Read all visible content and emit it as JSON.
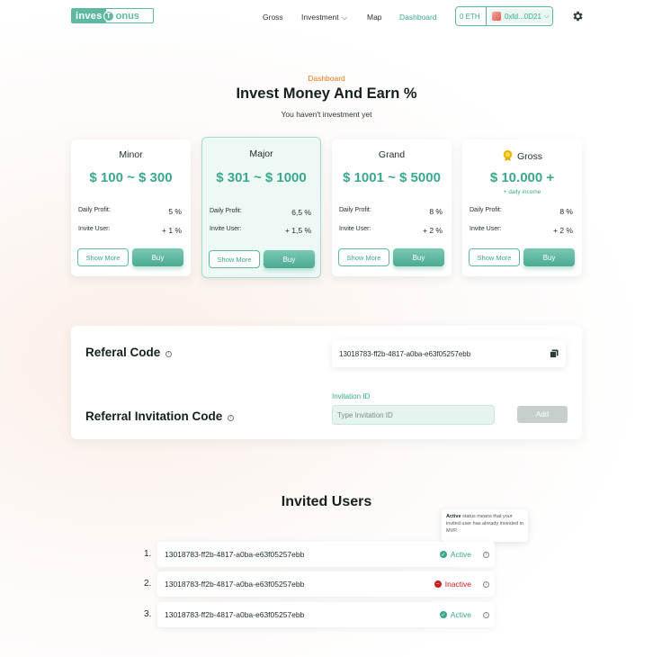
{
  "header": {
    "logo_left": "inves",
    "logo_mid": "T",
    "logo_right": "onus",
    "nav": [
      "Gross",
      "Investment",
      "Map",
      "Dashboard"
    ],
    "investment_chevron": "⌵",
    "wallet": {
      "balance": "0 ETH",
      "address": "0xfd...0D21"
    }
  },
  "hero": {
    "eyebrow": "Dashboard",
    "title": "Invest Money And Earn %",
    "subtitle": "You haven't investment yet"
  },
  "plans": [
    {
      "name": "Minor",
      "price": "$ 100 ~ $ 300",
      "profit_label": "Daily Profit:",
      "profit": "5 %",
      "invite_label": "Invite User:",
      "invite": "+ 1 %",
      "more": "Show More",
      "buy": "Buy"
    },
    {
      "name": "Major",
      "price": "$ 301 ~ $ 1000",
      "profit_label": "Daily Profit:",
      "profit": "6,5 %",
      "invite_label": "Invite User:",
      "invite": "+ 1,5 %",
      "more": "Show More",
      "buy": "Buy"
    },
    {
      "name": "Grand",
      "price": "$ 1001 ~ $ 5000",
      "profit_label": "Daily Profit:",
      "profit": "8 %",
      "invite_label": "Invite User:",
      "invite": "+ 2 %",
      "more": "Show More",
      "buy": "Buy"
    },
    {
      "name": "Gross",
      "price": "$ 10.000 +",
      "note": "+ daily income",
      "profit_label": "Daily Profit:",
      "profit": "8 %",
      "invite_label": "Invite User:",
      "invite": "+ 2 %",
      "more": "Show More",
      "buy": "Buy"
    }
  ],
  "referral": {
    "code_title": "Referal Code",
    "code_value": "13018783-ff2b-4817-a0ba-e63f05257ebb",
    "invite_title": "Referral Invitation Code",
    "invite_label": "Invitation ID",
    "invite_placeholder": "Type Invitation ID",
    "add_label": "Add"
  },
  "invited": {
    "title": "Invited Users",
    "tooltip_bold": "Active",
    "tooltip_text": " status means that your invited user has already invested in MVP.",
    "users": [
      {
        "num": "1.",
        "code": "13018783-ff2b-4817-a0ba-e63f05257ebb",
        "status": "Active"
      },
      {
        "num": "2.",
        "code": "13018783-ff2b-4817-a0ba-e63f05257ebb",
        "status": "Inactive"
      },
      {
        "num": "3.",
        "code": "13018783-ff2b-4817-a0ba-e63f05257ebb",
        "status": "Active"
      }
    ]
  },
  "colors": {
    "accent": "#3aa88f",
    "orange": "#e1791a",
    "inactive": "#c81e1e"
  },
  "icons": [
    "gear-icon",
    "copy-icon",
    "info-icon",
    "medal-icon",
    "check-icon",
    "minus-icon",
    "chevron-down-icon"
  ]
}
